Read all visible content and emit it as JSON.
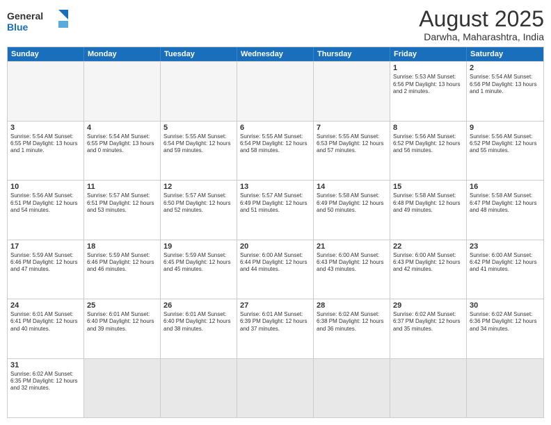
{
  "logo": {
    "general": "General",
    "blue": "Blue"
  },
  "header": {
    "title": "August 2025",
    "subtitle": "Darwha, Maharashtra, India"
  },
  "days": [
    "Sunday",
    "Monday",
    "Tuesday",
    "Wednesday",
    "Thursday",
    "Friday",
    "Saturday"
  ],
  "weeks": [
    [
      {
        "day": "",
        "content": ""
      },
      {
        "day": "",
        "content": ""
      },
      {
        "day": "",
        "content": ""
      },
      {
        "day": "",
        "content": ""
      },
      {
        "day": "",
        "content": ""
      },
      {
        "day": "1",
        "content": "Sunrise: 5:53 AM\nSunset: 6:56 PM\nDaylight: 13 hours and 2 minutes."
      },
      {
        "day": "2",
        "content": "Sunrise: 5:54 AM\nSunset: 6:56 PM\nDaylight: 13 hours and 1 minute."
      }
    ],
    [
      {
        "day": "3",
        "content": "Sunrise: 5:54 AM\nSunset: 6:55 PM\nDaylight: 13 hours and 1 minute."
      },
      {
        "day": "4",
        "content": "Sunrise: 5:54 AM\nSunset: 6:55 PM\nDaylight: 13 hours and 0 minutes."
      },
      {
        "day": "5",
        "content": "Sunrise: 5:55 AM\nSunset: 6:54 PM\nDaylight: 12 hours and 59 minutes."
      },
      {
        "day": "6",
        "content": "Sunrise: 5:55 AM\nSunset: 6:54 PM\nDaylight: 12 hours and 58 minutes."
      },
      {
        "day": "7",
        "content": "Sunrise: 5:55 AM\nSunset: 6:53 PM\nDaylight: 12 hours and 57 minutes."
      },
      {
        "day": "8",
        "content": "Sunrise: 5:56 AM\nSunset: 6:52 PM\nDaylight: 12 hours and 56 minutes."
      },
      {
        "day": "9",
        "content": "Sunrise: 5:56 AM\nSunset: 6:52 PM\nDaylight: 12 hours and 55 minutes."
      }
    ],
    [
      {
        "day": "10",
        "content": "Sunrise: 5:56 AM\nSunset: 6:51 PM\nDaylight: 12 hours and 54 minutes."
      },
      {
        "day": "11",
        "content": "Sunrise: 5:57 AM\nSunset: 6:51 PM\nDaylight: 12 hours and 53 minutes."
      },
      {
        "day": "12",
        "content": "Sunrise: 5:57 AM\nSunset: 6:50 PM\nDaylight: 12 hours and 52 minutes."
      },
      {
        "day": "13",
        "content": "Sunrise: 5:57 AM\nSunset: 6:49 PM\nDaylight: 12 hours and 51 minutes."
      },
      {
        "day": "14",
        "content": "Sunrise: 5:58 AM\nSunset: 6:49 PM\nDaylight: 12 hours and 50 minutes."
      },
      {
        "day": "15",
        "content": "Sunrise: 5:58 AM\nSunset: 6:48 PM\nDaylight: 12 hours and 49 minutes."
      },
      {
        "day": "16",
        "content": "Sunrise: 5:58 AM\nSunset: 6:47 PM\nDaylight: 12 hours and 48 minutes."
      }
    ],
    [
      {
        "day": "17",
        "content": "Sunrise: 5:59 AM\nSunset: 6:46 PM\nDaylight: 12 hours and 47 minutes."
      },
      {
        "day": "18",
        "content": "Sunrise: 5:59 AM\nSunset: 6:46 PM\nDaylight: 12 hours and 46 minutes."
      },
      {
        "day": "19",
        "content": "Sunrise: 5:59 AM\nSunset: 6:45 PM\nDaylight: 12 hours and 45 minutes."
      },
      {
        "day": "20",
        "content": "Sunrise: 6:00 AM\nSunset: 6:44 PM\nDaylight: 12 hours and 44 minutes."
      },
      {
        "day": "21",
        "content": "Sunrise: 6:00 AM\nSunset: 6:43 PM\nDaylight: 12 hours and 43 minutes."
      },
      {
        "day": "22",
        "content": "Sunrise: 6:00 AM\nSunset: 6:43 PM\nDaylight: 12 hours and 42 minutes."
      },
      {
        "day": "23",
        "content": "Sunrise: 6:00 AM\nSunset: 6:42 PM\nDaylight: 12 hours and 41 minutes."
      }
    ],
    [
      {
        "day": "24",
        "content": "Sunrise: 6:01 AM\nSunset: 6:41 PM\nDaylight: 12 hours and 40 minutes."
      },
      {
        "day": "25",
        "content": "Sunrise: 6:01 AM\nSunset: 6:40 PM\nDaylight: 12 hours and 39 minutes."
      },
      {
        "day": "26",
        "content": "Sunrise: 6:01 AM\nSunset: 6:40 PM\nDaylight: 12 hours and 38 minutes."
      },
      {
        "day": "27",
        "content": "Sunrise: 6:01 AM\nSunset: 6:39 PM\nDaylight: 12 hours and 37 minutes."
      },
      {
        "day": "28",
        "content": "Sunrise: 6:02 AM\nSunset: 6:38 PM\nDaylight: 12 hours and 36 minutes."
      },
      {
        "day": "29",
        "content": "Sunrise: 6:02 AM\nSunset: 6:37 PM\nDaylight: 12 hours and 35 minutes."
      },
      {
        "day": "30",
        "content": "Sunrise: 6:02 AM\nSunset: 6:36 PM\nDaylight: 12 hours and 34 minutes."
      }
    ],
    [
      {
        "day": "31",
        "content": "Sunrise: 6:02 AM\nSunset: 6:35 PM\nDaylight: 12 hours and 32 minutes."
      },
      {
        "day": "",
        "content": ""
      },
      {
        "day": "",
        "content": ""
      },
      {
        "day": "",
        "content": ""
      },
      {
        "day": "",
        "content": ""
      },
      {
        "day": "",
        "content": ""
      },
      {
        "day": "",
        "content": ""
      }
    ]
  ]
}
